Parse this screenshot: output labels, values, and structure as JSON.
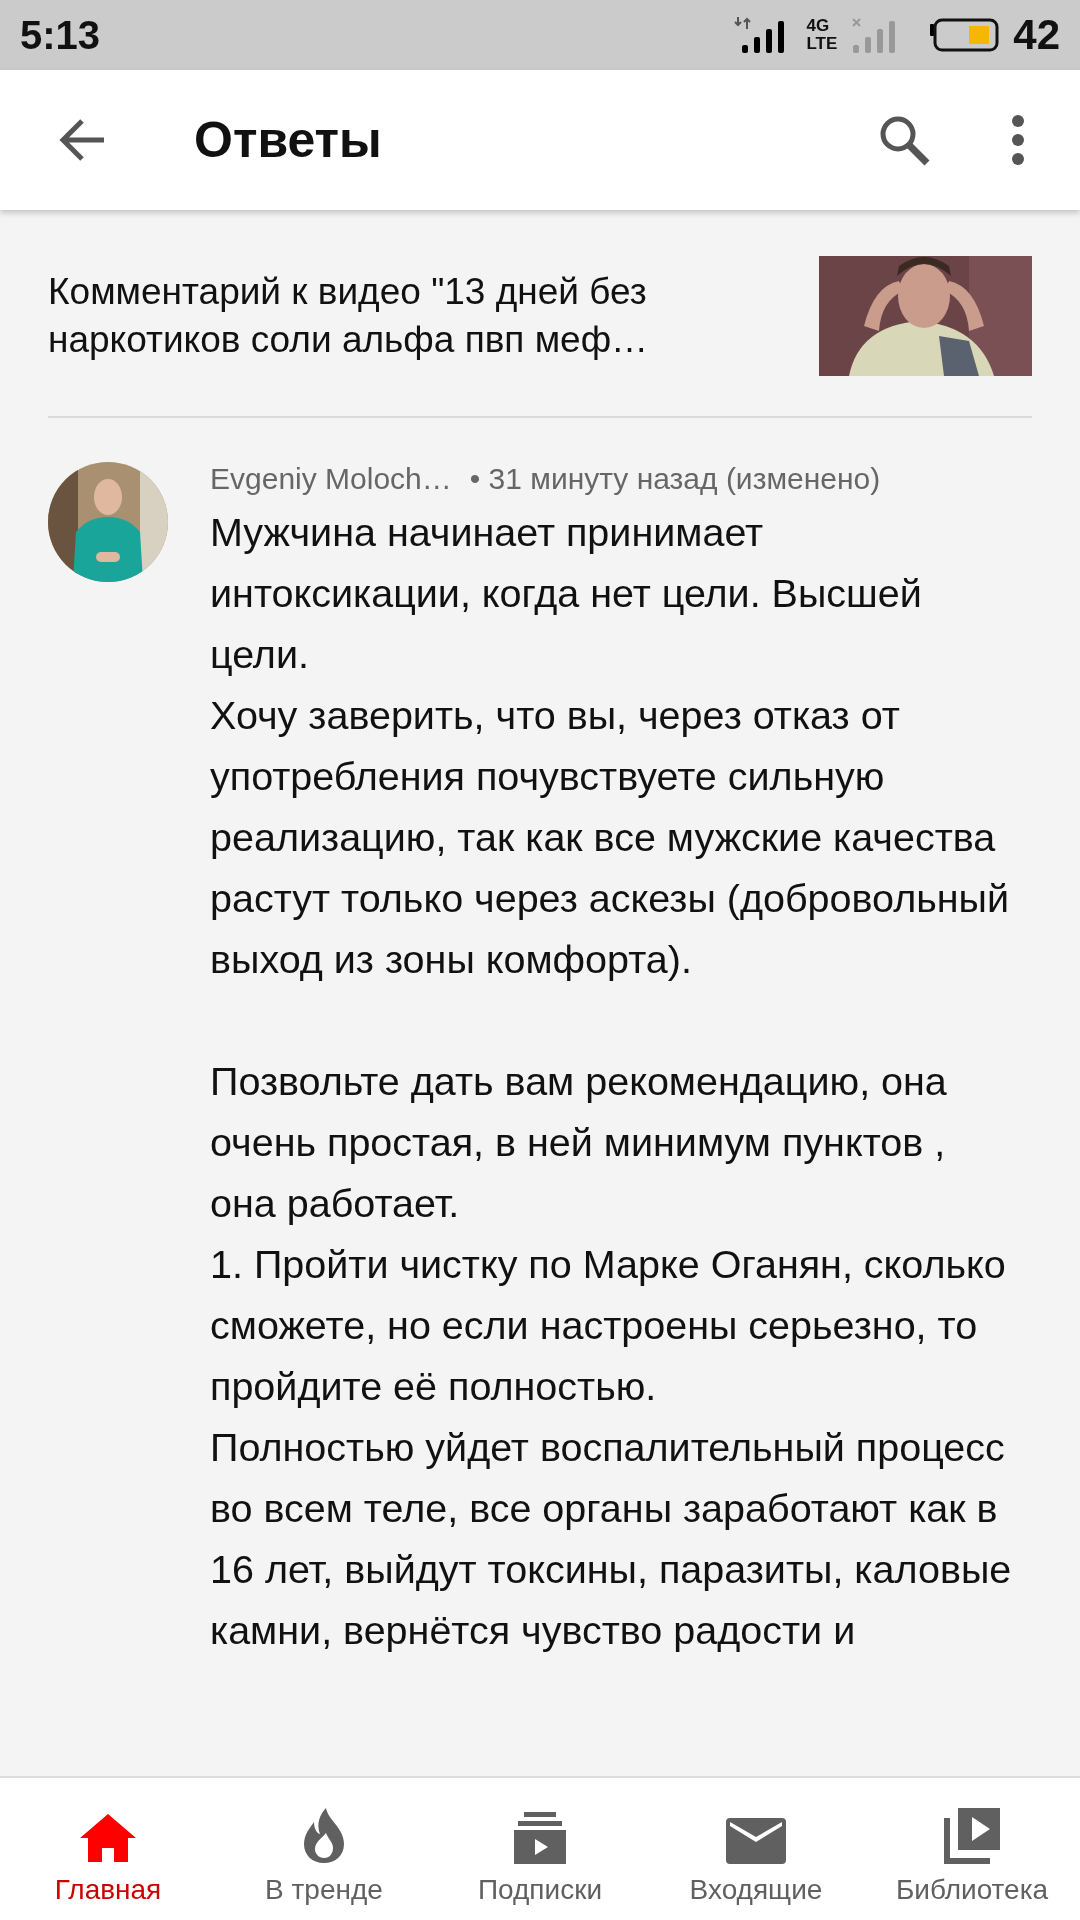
{
  "status_bar": {
    "time": "5:13",
    "network": "4G",
    "network_sub": "LTE",
    "battery": "42"
  },
  "app_bar": {
    "title": "Ответы"
  },
  "video": {
    "title": "Комментарий к видео \"13 дней без наркотиков соли альфа пвп меф…"
  },
  "comment": {
    "author": "Evgeniy Moloch…",
    "time": "• 31 минуту назад (изменено)",
    "paragraphs": [
      {
        "text": "Мужчина начинает принимает интоксикации, когда нет цели. Высшей цели.",
        "blank_line_before": false
      },
      {
        "text": "Хочу заверить, что вы, через отказ от употребления почувствуете сильную реализацию, так как все мужские качества растут только через аскезы (добровольный выход из зоны комфорта).",
        "blank_line_before": false
      },
      {
        "text": "Позвольте дать вам рекомендацию, она очень простая, в ней минимум пунктов , она работает.",
        "blank_line_before": true
      },
      {
        "text": "1. Пройти чистку по Марке Оганян, сколько сможете, но если настроены серьезно, то пройдите её полностью.",
        "blank_line_before": false
      },
      {
        "text": "Полностью уйдет воспалительный процесс во всем теле, все органы заработают как в 16 лет, выйдут токсины, паразиты, каловые камни, вернётся чувство радости и",
        "blank_line_before": false
      }
    ]
  },
  "bottom_nav": [
    {
      "kind": "home",
      "label": "Главная",
      "selected": true
    },
    {
      "kind": "trending",
      "label": "В тренде",
      "selected": false
    },
    {
      "kind": "subscriptions",
      "label": "Подписки",
      "selected": false
    },
    {
      "kind": "inbox",
      "label": "Входящие",
      "selected": false
    },
    {
      "kind": "library",
      "label": "Библиотека",
      "selected": false
    }
  ]
}
